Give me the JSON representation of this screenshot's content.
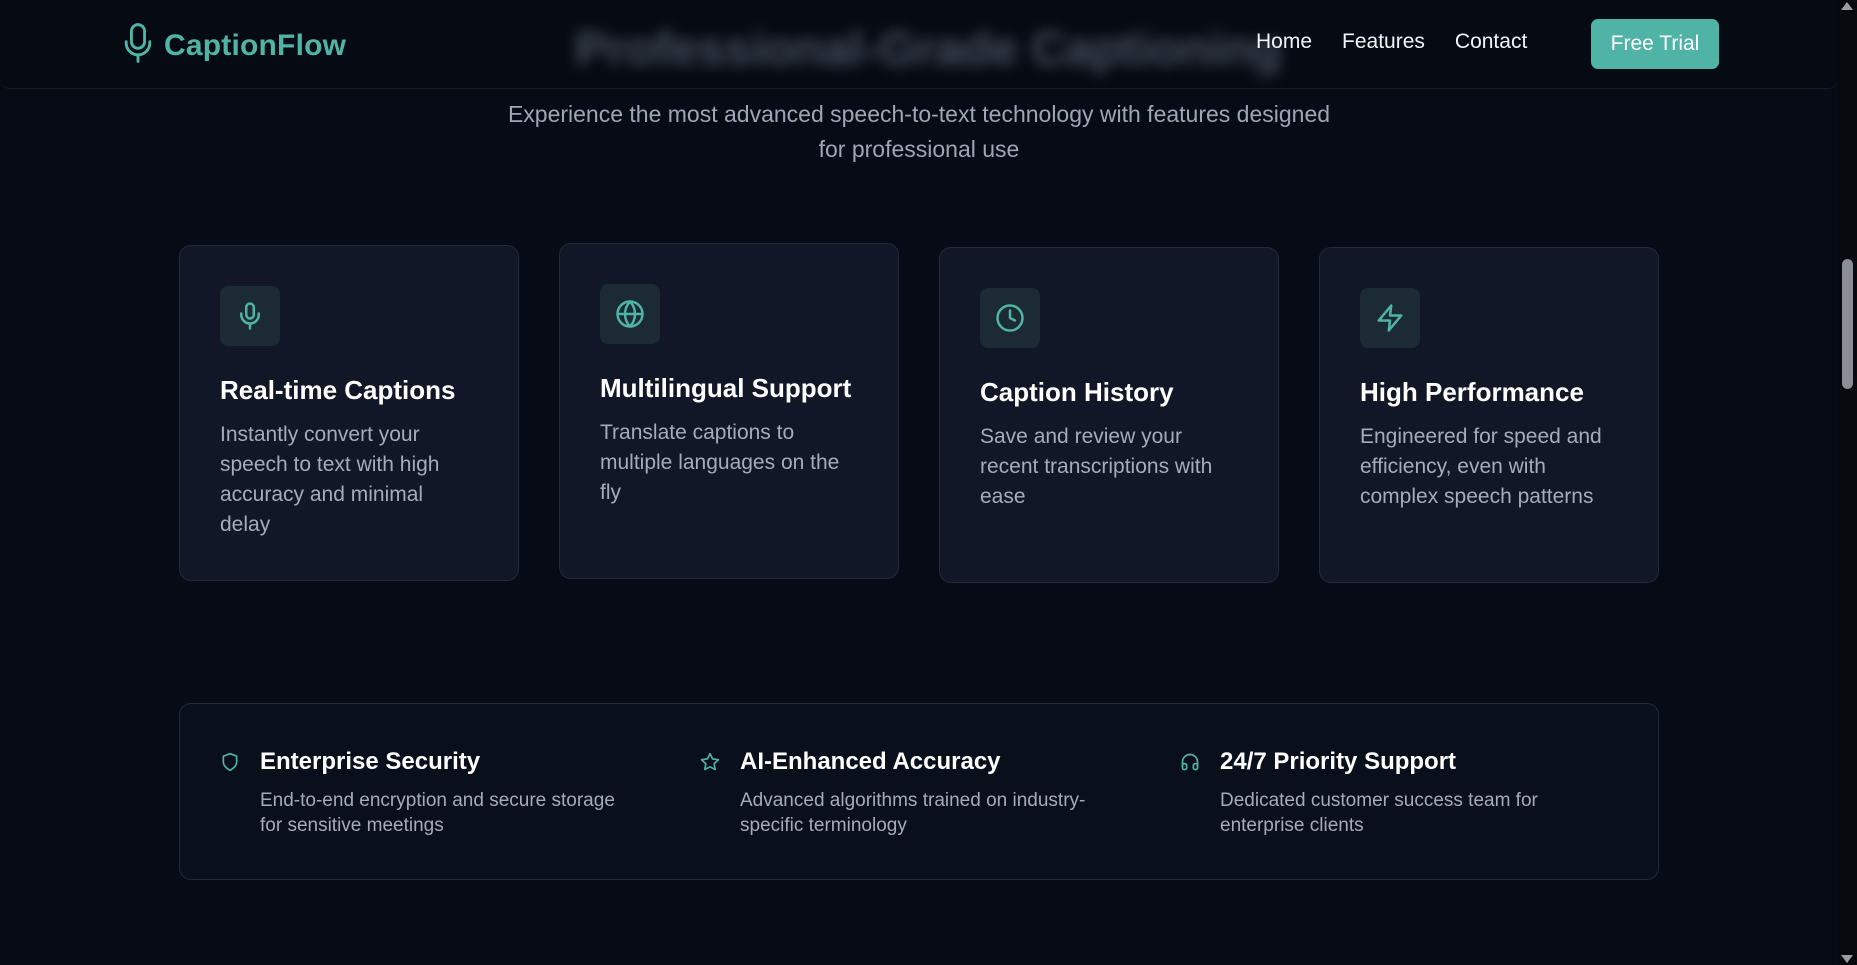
{
  "header": {
    "brand": "CaptionFlow",
    "brand_icon": "microphone-icon",
    "obscured_title": "Professional-Grade Captioning",
    "nav": [
      "Home",
      "Features",
      "Contact"
    ],
    "cta_label": "Free Trial"
  },
  "section": {
    "subtitle": "Experience the most advanced speech-to-text technology with features designed for professional use"
  },
  "features": [
    {
      "icon": "microphone-icon",
      "title": "Real-time Captions",
      "description": "Instantly convert your speech to text with high accuracy and minimal delay"
    },
    {
      "icon": "globe-icon",
      "title": "Multilingual Support",
      "description": "Translate captions to multiple languages on the fly"
    },
    {
      "icon": "clock-icon",
      "title": "Caption History",
      "description": "Save and review your recent transcriptions with ease"
    },
    {
      "icon": "lightning-icon",
      "title": "High Performance",
      "description": "Engineered for speed and efficiency, even with complex speech patterns"
    }
  ],
  "benefits": [
    {
      "icon": "shield-icon",
      "title": "Enterprise Security",
      "description": "End-to-end encryption and secure storage for sensitive meetings"
    },
    {
      "icon": "star-icon",
      "title": "AI-Enhanced Accuracy",
      "description": "Advanced algorithms trained on industry-specific terminology"
    },
    {
      "icon": "headphones-icon",
      "title": "24/7 Priority Support",
      "description": "Dedicated customer success team for enterprise clients"
    }
  ],
  "colors": {
    "accent": "#4fb3a5",
    "background": "#070b16",
    "card": "#111726",
    "muted_text": "#a4acba"
  }
}
